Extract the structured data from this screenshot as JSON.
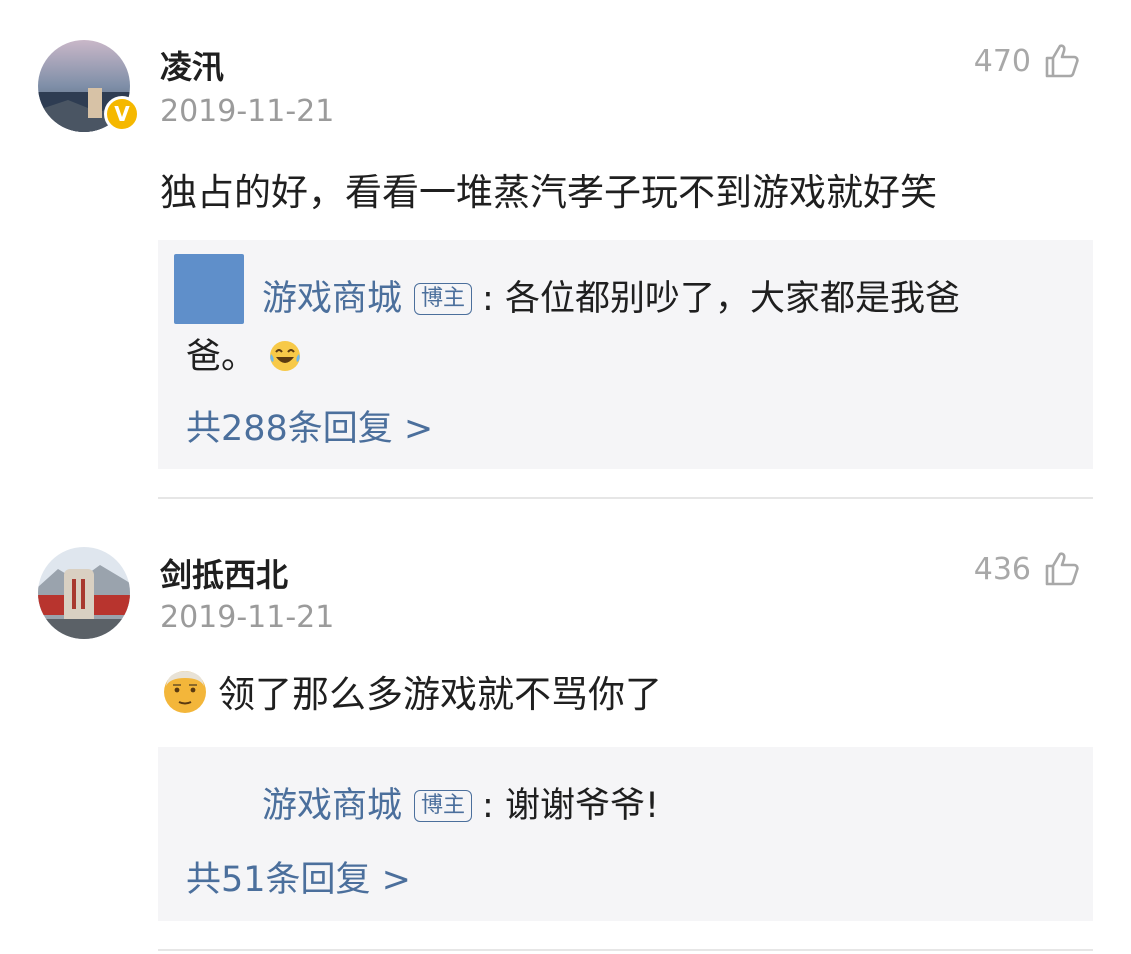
{
  "comments": [
    {
      "username": "凌汛",
      "date": "2019-11-21",
      "likes": "470",
      "verified": true,
      "text": "独占的好，看看一堆蒸汽孝子玩不到游戏就好笑",
      "reply": {
        "author": "游戏商城",
        "tag": "博主",
        "text_line1": ": 各位都别吵了，大家都是我爸",
        "text_line2": "爸。",
        "emoji": "laughing-crying-emoji",
        "count_label": "共288条回复 >"
      }
    },
    {
      "username": "剑抵西北",
      "date": "2019-11-21",
      "likes": "436",
      "verified": false,
      "text": "领了那么多游戏就不骂你了",
      "emoji": "old-man-emoji",
      "reply": {
        "author": "游戏商城",
        "tag": "博主",
        "text_line1": ": 谢谢爷爷!",
        "count_label": "共51条回复 >"
      }
    }
  ],
  "colors": {
    "link": "#4b6f9c",
    "muted": "#9b9b9b",
    "reply_bg": "#f5f5f7",
    "verified_badge": "#f5b800"
  }
}
